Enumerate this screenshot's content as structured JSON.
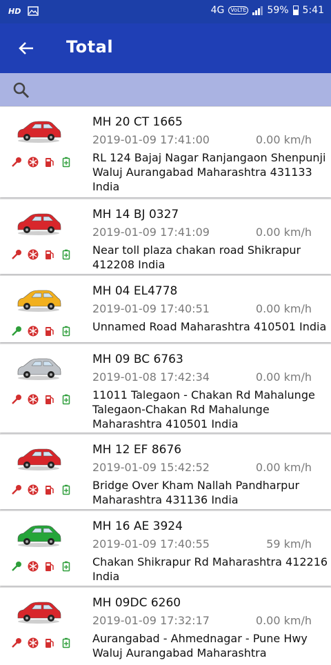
{
  "status_bar": {
    "left_label": "HD",
    "network": "4G",
    "volte": "VoLTE",
    "battery": "59%",
    "time": "5:41"
  },
  "header": {
    "title": "Total"
  },
  "vehicles": [
    {
      "plate": "MH  20 CT 1665",
      "datetime": "2019-01-09 17:41:00",
      "speed": "0.00 km/h",
      "address": "RL 124 Bajaj Nagar Ranjangaon Shenpunji Waluj Aurangabad Maharashtra 431133 India",
      "car_color": "#d8262b",
      "key_color": "#d32f2f"
    },
    {
      "plate": "MH 14 BJ 0327",
      "datetime": "2019-01-09 17:41:09",
      "speed": "0.00 km/h",
      "address": "Near toll plaza chakan road Shikrapur 412208 India",
      "car_color": "#d8262b",
      "key_color": "#d32f2f"
    },
    {
      "plate": "MH 04 EL4778",
      "datetime": "2019-01-09 17:40:51",
      "speed": "0.00 km/h",
      "address": "Unnamed Road Maharashtra 410501 India",
      "car_color": "#f2b01e",
      "key_color": "#2e9e3a"
    },
    {
      "plate": "MH 09 BC 6763",
      "datetime": "2019-01-08 17:42:34",
      "speed": "0.00 km/h",
      "address": "11011 Talegaon - Chakan Rd Mahalunge Talegaon-Chakan Rd Mahalunge Maharashtra 410501 India",
      "car_color": "#bfc3c8",
      "key_color": "#d32f2f"
    },
    {
      "plate": "MH 12 EF 8676",
      "datetime": "2019-01-09 15:42:52",
      "speed": "0.00 km/h",
      "address": "Bridge Over Kham Nallah Pandharpur Maharashtra 431136 India",
      "car_color": "#d8262b",
      "key_color": "#d32f2f"
    },
    {
      "plate": "MH 16 AE 3924",
      "datetime": "2019-01-09 17:40:55",
      "speed": "59 km/h",
      "address": "Chakan Shikrapur Rd Maharashtra 412216 India",
      "car_color": "#25a53a",
      "key_color": "#2e9e3a"
    },
    {
      "plate": "MH 09DC 6260",
      "datetime": "2019-01-09 17:32:17",
      "speed": "0.00 km/h",
      "address": "Aurangabad - Ahmednagar - Pune Hwy Waluj Aurangabad Maharashtra",
      "car_color": "#d8262b",
      "key_color": "#d32f2f"
    }
  ],
  "icons": {
    "back": "arrow-back-icon",
    "search": "search-icon",
    "ignition": "key-icon",
    "ac": "snowflake-icon",
    "fuel": "fuel-pump-icon",
    "battery": "battery-icon"
  }
}
